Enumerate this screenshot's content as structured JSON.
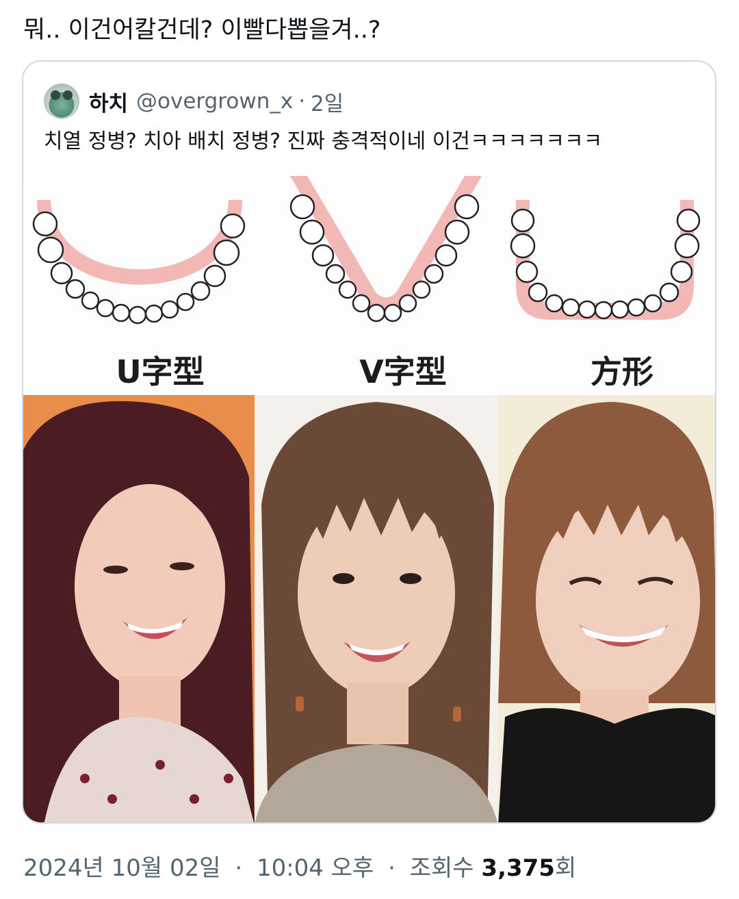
{
  "tweet": {
    "text": "뭐.. 이건어칼건데? 이빨다뽑을겨..?"
  },
  "quote": {
    "display_name": "하치",
    "handle": "@overgrown_x",
    "separator": "·",
    "time": "2일",
    "text": "치열 정병? 치아 배치 정병? 진짜 충격적이네 이건ㅋㅋㅋㅋㅋㅋㅋ",
    "media": {
      "arch_labels": [
        "U字型",
        "V字型",
        "方形"
      ]
    }
  },
  "footer": {
    "date": "2024년 10월 02일",
    "time": "10:04 오후",
    "views_label_prefix": "조회수",
    "views_count": "3,375",
    "views_label_suffix": "회",
    "separator": "·"
  },
  "colors": {
    "text": "#0f1419",
    "secondary_text": "#536471",
    "border": "#cfd9de",
    "gum": "#f2b8b5"
  }
}
